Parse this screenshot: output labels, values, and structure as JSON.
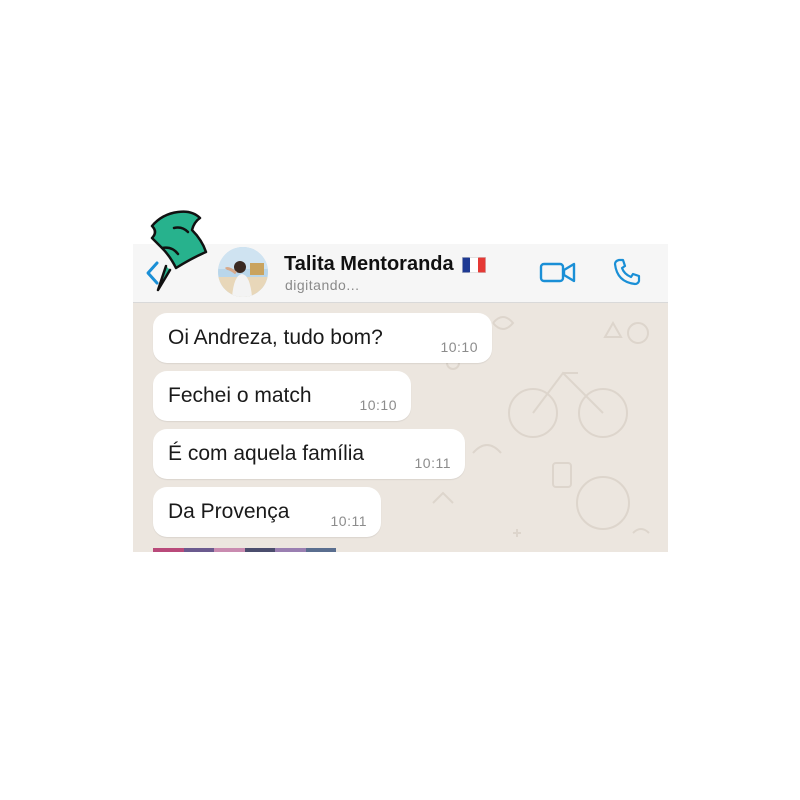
{
  "header": {
    "contact_name": "Talita Mentoranda",
    "status": "digitando...",
    "flag_icon": "france-flag-icon",
    "accent_color": "#1a8fd6"
  },
  "messages": [
    {
      "text": "Oi Andreza, tudo bom?",
      "time": "10:10"
    },
    {
      "text": "Fechei o match",
      "time": "10:10"
    },
    {
      "text": "É com aquela família",
      "time": "10:11"
    },
    {
      "text": "Da Provença",
      "time": "10:11"
    }
  ],
  "decoration": {
    "pin_icon": "green-pushpin-icon",
    "pin_color": "#27b28d"
  }
}
